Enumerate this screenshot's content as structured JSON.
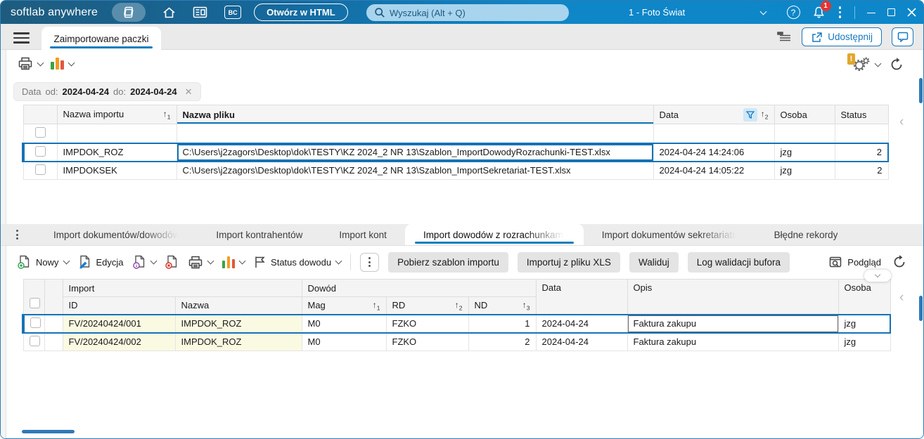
{
  "icons": {
    "bc": "BC",
    "help_glyph": "?",
    "warning_glyph": "!",
    "chip_close": "✕",
    "sort_arrow": "↑",
    "collapse_chevron": "‹"
  },
  "titlebar": {
    "app_name": "softlab anywhere",
    "open_html_button": "Otwórz w HTML",
    "search_placeholder": "Wyszukaj (Alt + Q)",
    "company": "1 - Foto Świat",
    "notification_count": "1"
  },
  "tabbar": {
    "active_tab": "Zaimportowane paczki",
    "share_button": "Udostępnij"
  },
  "filter_chip": {
    "field": "Data",
    "od_label": "od:",
    "od_value": "2024-04-24",
    "do_label": "do:",
    "do_value": "2024-04-24"
  },
  "top_table": {
    "headers": {
      "nazwa_importu": "Nazwa importu",
      "nazwa_pliku": "Nazwa pliku",
      "data": "Data",
      "osoba": "Osoba",
      "status": "Status"
    },
    "sort": {
      "nazwa_importu": "1",
      "data": "2"
    },
    "rows": [
      {
        "nazwa_importu": "IMPDOK_ROZ",
        "nazwa_pliku": "C:\\Users\\j2zagors\\Desktop\\dok\\TESTY\\KZ 2024_2 NR 13\\Szablon_ImportDowodyRozrachunki-TEST.xlsx",
        "data": "2024-04-24 14:24:06",
        "osoba": "jzg",
        "status": "2"
      },
      {
        "nazwa_importu": "IMPDOKSEK",
        "nazwa_pliku": "C:\\Users\\j2zagors\\Desktop\\dok\\TESTY\\KZ 2024_2 NR 13\\Szablon_ImportSekretariat-TEST.xlsx",
        "data": "2024-04-24 14:05:22",
        "osoba": "jzg",
        "status": "2"
      }
    ]
  },
  "bottom_tabs": {
    "items": [
      "Import dokumentów/dowodów",
      "Import kontrahentów",
      "Import kont",
      "Import dowodów z rozrachunkami",
      "Import dokumentów sekretariatu",
      "Błędne rekordy"
    ],
    "active_index": 3
  },
  "toolbar_bottom": {
    "new_label": "Nowy",
    "edit_label": "Edycja",
    "status_label": "Status dowodu",
    "download_template": "Pobierz szablon importu",
    "import_xls": "Importuj z pliku XLS",
    "validate": "Waliduj",
    "validation_log": "Log walidacji bufora",
    "preview": "Podgląd"
  },
  "bottom_table": {
    "groups": {
      "import": "Import",
      "dowod": "Dowód"
    },
    "headers": {
      "id": "ID",
      "nazwa": "Nazwa",
      "mag": "Mag",
      "rd": "RD",
      "nd": "ND",
      "data": "Data",
      "opis": "Opis",
      "osoba": "Osoba"
    },
    "sort": {
      "mag": "1",
      "rd": "2",
      "nd": "3"
    },
    "rows": [
      {
        "id": "FV/20240424/001",
        "nazwa": "IMPDOK_ROZ",
        "mag": "M0",
        "rd": "FZKO",
        "nd": "1",
        "data": "2024-04-24",
        "opis": "Faktura zakupu",
        "osoba": "jzg"
      },
      {
        "id": "FV/20240424/002",
        "nazwa": "IMPDOK_ROZ",
        "mag": "M0",
        "rd": "FZKO",
        "nd": "2",
        "data": "2024-04-24",
        "opis": "Faktura zakupu",
        "osoba": "jzg"
      }
    ]
  },
  "colors": {
    "accent": "#0f7dc0",
    "selected_border": "#1572b6",
    "titlebar_left": "#1e5c7e",
    "titlebar_right": "#0e86c7",
    "badge": "#e5342f",
    "cell_highlight": "#fafae3"
  }
}
